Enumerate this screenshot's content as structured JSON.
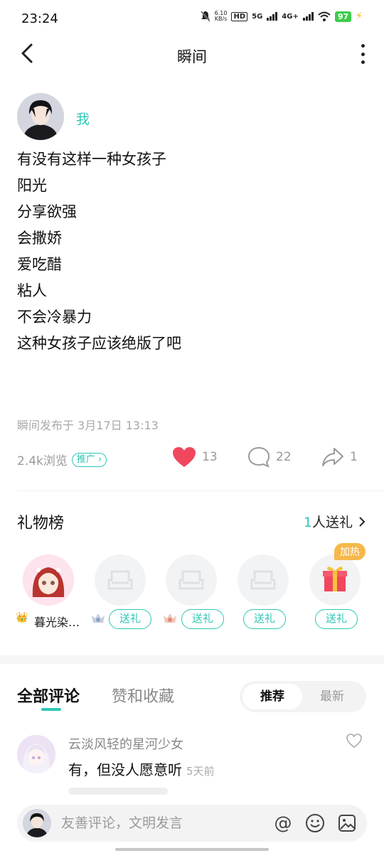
{
  "status_bar": {
    "time": "23:24",
    "speed_value": "6.10",
    "speed_unit": "KB/s",
    "hd": "HD",
    "network_5g": "5G",
    "network_4g": "4G+",
    "battery": "97"
  },
  "header": {
    "title": "瞬间"
  },
  "post": {
    "author": "我",
    "lines": [
      "有没有这样一种女孩子",
      "阳光",
      "分享欲强",
      "会撒娇",
      "爱吃醋",
      "粘人",
      "不会冷暴力",
      "这种女孩子应该绝版了吧"
    ],
    "published": "瞬间发布于 3月17日 13:13",
    "views": "2.4k浏览",
    "promote_label": "推广",
    "likes": "13",
    "comments": "22",
    "shares": "1"
  },
  "gift_board": {
    "title": "礼物榜",
    "giver_count": "1",
    "giver_suffix": "人送礼",
    "top_giver": "暮光染…",
    "send_label": "送礼",
    "hot_tag": "加热"
  },
  "comments_section": {
    "tab_all": "全部评论",
    "tab_likes": "赞和收藏",
    "sort_recommended": "推荐",
    "sort_latest": "最新",
    "items": [
      {
        "user": "云淡风轻的星河少女",
        "text": "有，但没人愿意听",
        "time": "5天前"
      }
    ]
  },
  "input_bar": {
    "placeholder": "友善评论，文明发言",
    "at_symbol": "@"
  },
  "colors": {
    "accent": "#2ec7b5",
    "like": "#f0465e",
    "hot_tag": "#f6b84b"
  }
}
